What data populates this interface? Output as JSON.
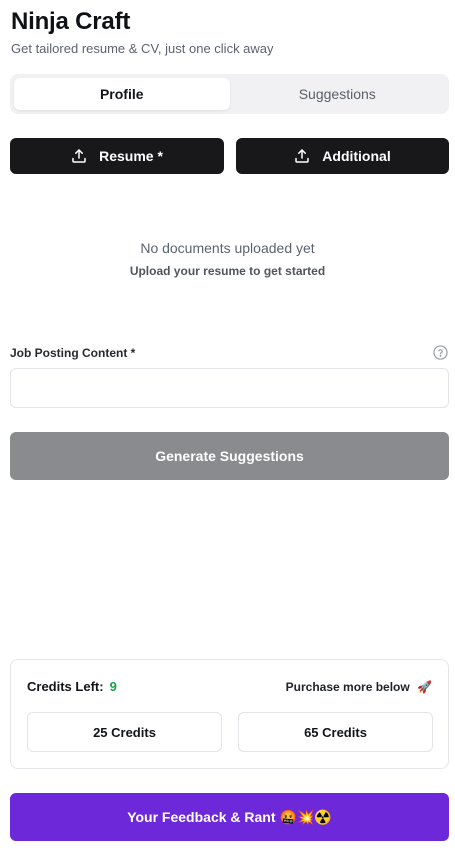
{
  "app": {
    "title": "Ninja Craft",
    "subtitle": "Get tailored resume & CV, just one click away"
  },
  "tabs": [
    {
      "label": "Profile",
      "active": true
    },
    {
      "label": "Suggestions",
      "active": false
    }
  ],
  "upload": {
    "resume_label": "Resume *",
    "additional_label": "Additional",
    "icon": "upload-icon"
  },
  "empty_state": {
    "title": "No documents uploaded yet",
    "subtitle": "Upload your resume to get started"
  },
  "job_posting": {
    "label": "Job Posting Content *",
    "value": "",
    "help_icon": "question-circle-icon"
  },
  "generate": {
    "label": "Generate Suggestions"
  },
  "credits": {
    "label": "Credits Left:",
    "count": "9",
    "purchase_text": "Purchase more below",
    "purchase_emoji": "🚀",
    "options": [
      "25 Credits",
      "65 Credits"
    ]
  },
  "feedback": {
    "label": "Your Feedback & Rant",
    "emojis": "🤬💥☢️"
  },
  "colors": {
    "primary_dark": "#18181b",
    "disabled_gray": "#8a8b8e",
    "accent_purple": "#6d28d9",
    "credits_green": "#16a34a"
  }
}
